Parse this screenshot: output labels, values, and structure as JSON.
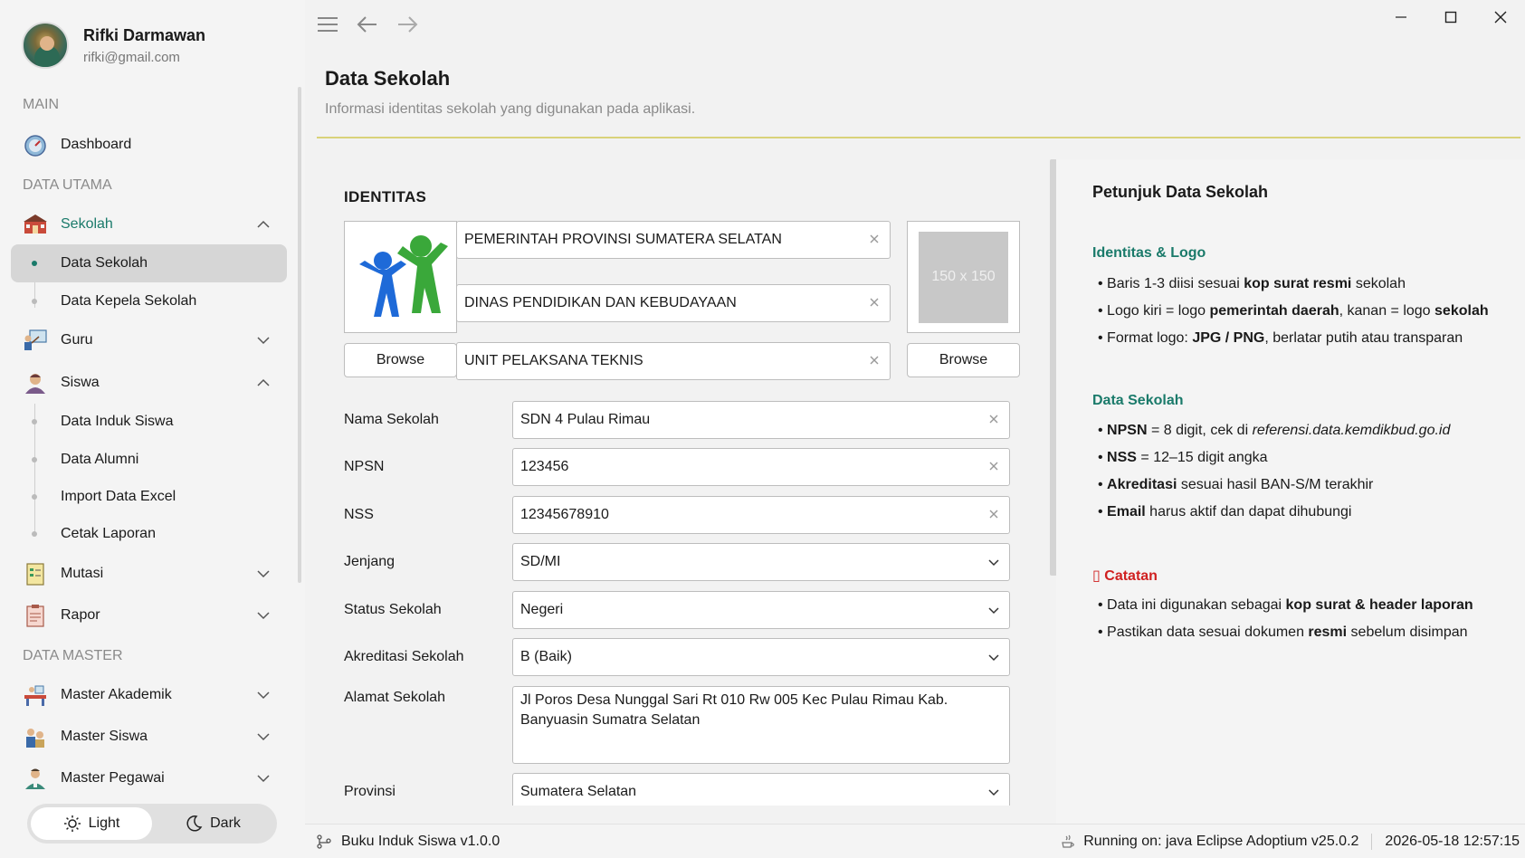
{
  "user": {
    "name": "Rifki Darmawan",
    "email": "rifki@gmail.com"
  },
  "nav": {
    "section_main": "MAIN",
    "dashboard": "Dashboard",
    "section_data_utama": "DATA UTAMA",
    "sekolah": "Sekolah",
    "sekolah_children": [
      "Data Sekolah",
      "Data Kepela Sekolah"
    ],
    "guru": "Guru",
    "siswa": "Siswa",
    "siswa_children": [
      "Data Induk Siswa",
      "Data Alumni",
      "Import Data Excel",
      "Cetak Laporan"
    ],
    "mutasi": "Mutasi",
    "rapor": "Rapor",
    "section_data_master": "DATA MASTER",
    "master_akademik": "Master Akademik",
    "master_siswa": "Master Siswa",
    "master_pegawai": "Master Pegawai"
  },
  "theme": {
    "light": "Light",
    "dark": "Dark",
    "selected": "Light"
  },
  "page": {
    "title": "Data Sekolah",
    "subtitle": "Informasi identitas sekolah yang digunakan pada aplikasi."
  },
  "identitas": {
    "heading": "IDENTITAS",
    "kop_line1": "PEMERINTAH PROVINSI SUMATERA SELATAN",
    "kop_line2": "DINAS PENDIDIKAN DAN KEBUDAYAAN",
    "kop_line3": "UNIT PELAKSANA TEKNIS",
    "browse_left": "Browse",
    "browse_right": "Browse",
    "placeholder_logo": "150 x 150"
  },
  "form": {
    "nama_sekolah": {
      "label": "Nama Sekolah",
      "value": "SDN 4 Pulau Rimau"
    },
    "npsn": {
      "label": "NPSN",
      "value": "123456"
    },
    "nss": {
      "label": "NSS",
      "value": "12345678910"
    },
    "jenjang": {
      "label": "Jenjang",
      "value": "SD/MI"
    },
    "status": {
      "label": "Status Sekolah",
      "value": "Negeri"
    },
    "akreditasi": {
      "label": "Akreditasi Sekolah",
      "value": "B (Baik)"
    },
    "alamat": {
      "label": "Alamat Sekolah",
      "value": "Jl Poros Desa Nunggal Sari Rt 010 Rw 005 Kec Pulau Rimau Kab. Banyuasin Sumatra Selatan"
    },
    "provinsi": {
      "label": "Provinsi",
      "value": "Sumatera Selatan"
    }
  },
  "help": {
    "title": "Petunjuk Data Sekolah",
    "sec1_title": "Identitas & Logo",
    "sec1_b1_a": "Baris 1-3 diisi sesuai ",
    "sec1_b1_b": "kop surat resmi",
    "sec1_b1_c": " sekolah",
    "sec1_b2_a": "Logo kiri = logo ",
    "sec1_b2_b": "pemerintah daerah",
    "sec1_b2_c": ", kanan = logo ",
    "sec1_b2_d": "sekolah",
    "sec1_b3_a": "Format logo: ",
    "sec1_b3_b": "JPG / PNG",
    "sec1_b3_c": ", berlatar putih atau transparan",
    "sec2_title": "Data Sekolah",
    "sec2_b1_a": "NPSN",
    "sec2_b1_b": " = 8 digit, cek di ",
    "sec2_b1_c": "referensi.data.kemdikbud.go.id",
    "sec2_b2_a": "NSS",
    "sec2_b2_b": " = 12–15 digit angka",
    "sec2_b3_a": "Akreditasi",
    "sec2_b3_b": " sesuai hasil BAN-S/M terakhir",
    "sec2_b4_a": "Email",
    "sec2_b4_b": " harus aktif dan dapat dihubungi",
    "sec3_title": "Catatan",
    "sec3_b1_a": "Data ini digunakan sebagai ",
    "sec3_b1_b": "kop surat & header laporan",
    "sec3_b2_a": "Pastikan data sesuai dokumen ",
    "sec3_b2_b": "resmi",
    "sec3_b2_c": " sebelum disimpan"
  },
  "status": {
    "app": "Buku Induk Siswa v1.0.0",
    "runtime": "Running on: java Eclipse Adoptium v25.0.2",
    "datetime": "2026-05-18 12:57:15"
  },
  "colors": {
    "accent": "#1a7a6a",
    "note_red": "#d02020",
    "title_rule": "#d9d27a"
  }
}
